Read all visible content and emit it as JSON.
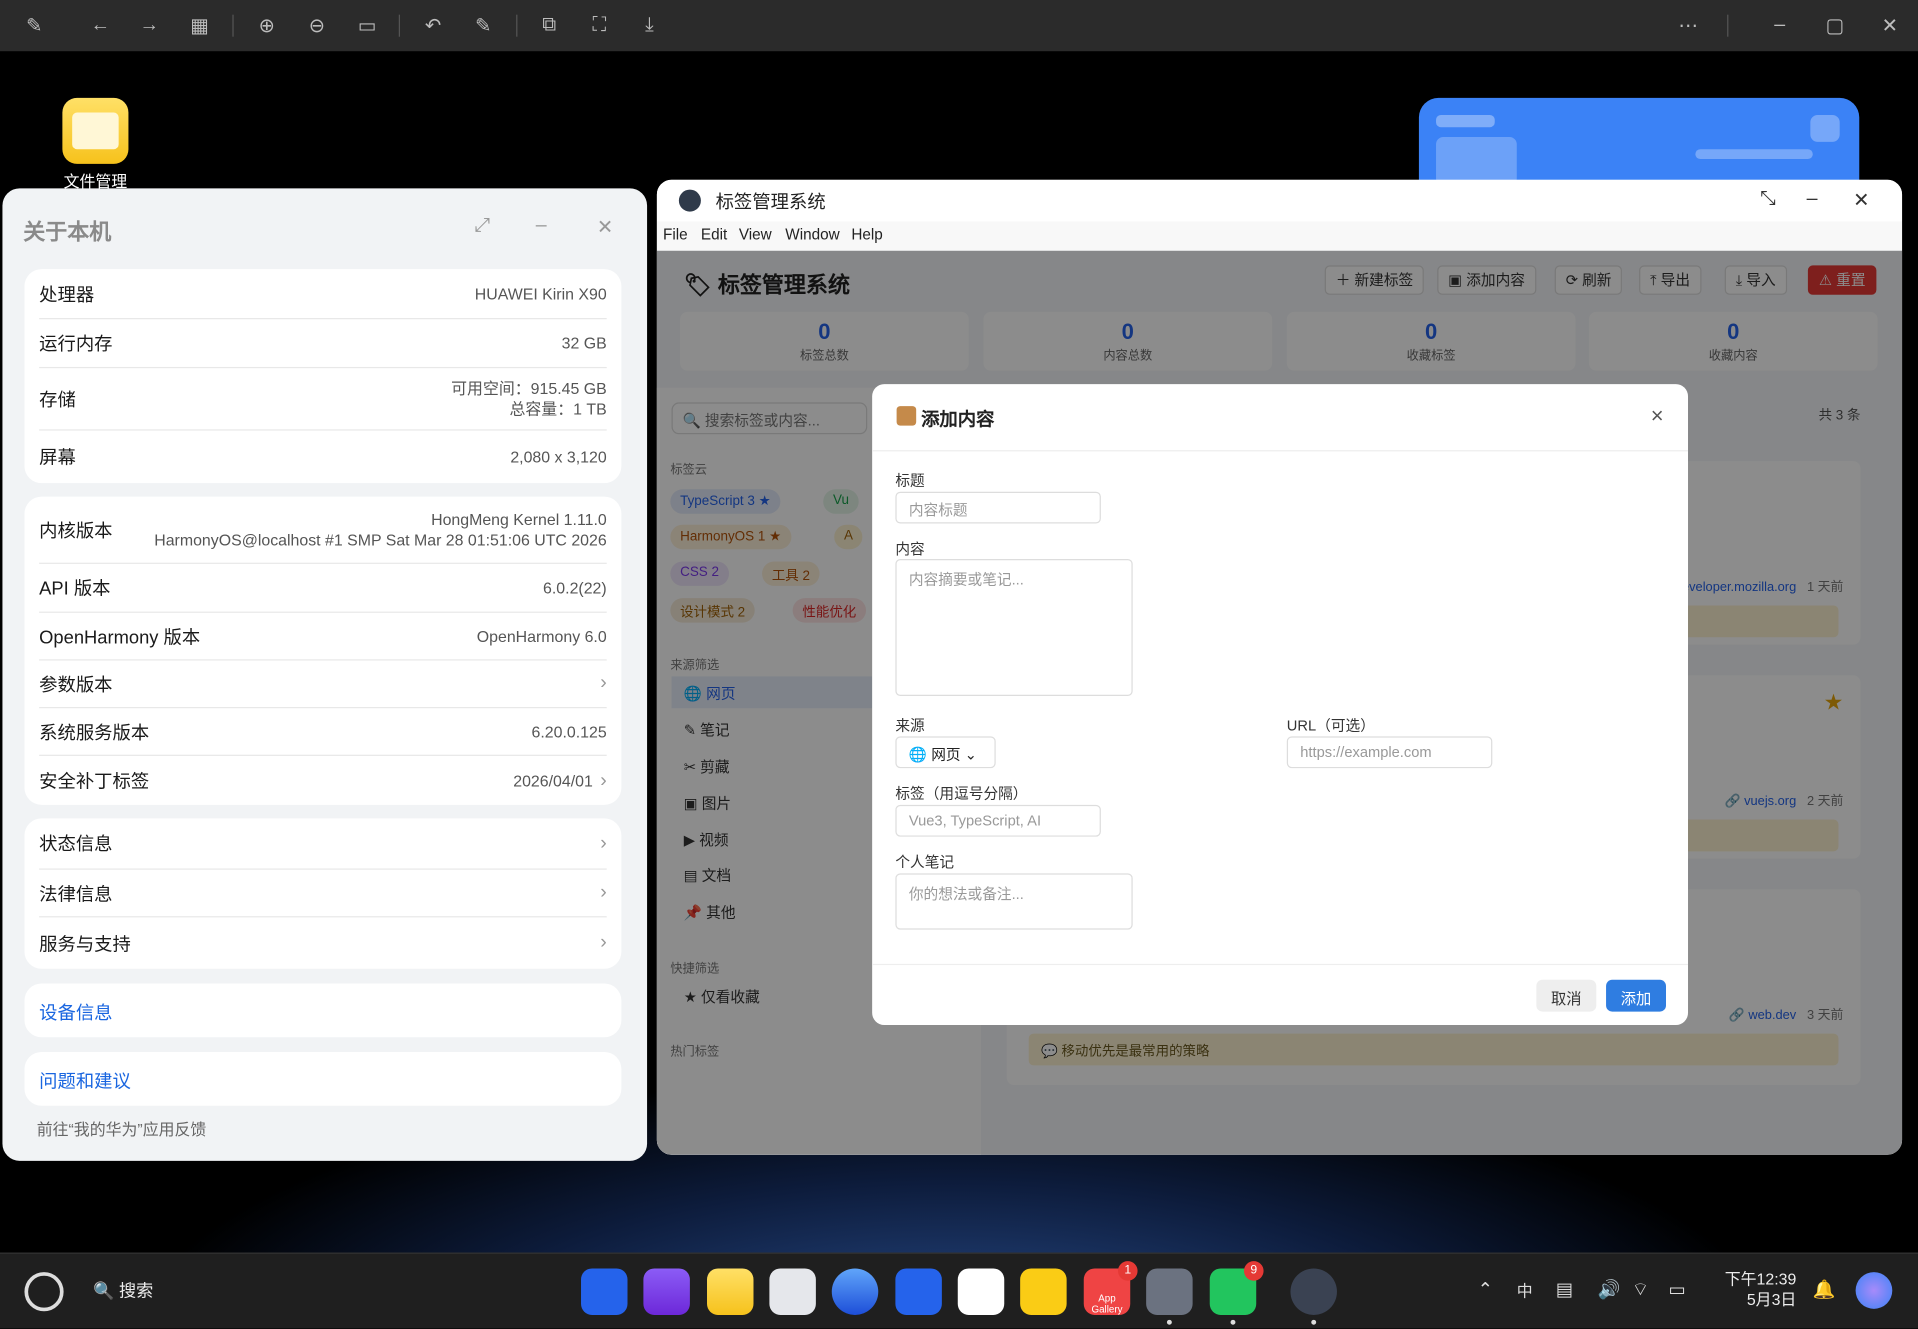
{
  "viewer_toolbar": {
    "icons": [
      "pin-icon",
      "back-icon",
      "forward-icon",
      "grid-icon",
      "zoom-in-icon",
      "zoom-out-icon",
      "actual-size-icon",
      "rotate-icon",
      "edit-icon",
      "crop-icon",
      "fit-icon",
      "save-icon",
      "more-icon",
      "minimize-icon",
      "maximize-icon",
      "close-icon"
    ]
  },
  "desktop": {
    "file_manager_label": "文件管理"
  },
  "about": {
    "title": "关于本机",
    "rows1": [
      {
        "k": "处理器",
        "v": "HUAWEI Kirin X90"
      },
      {
        "k": "运行内存",
        "v": "32 GB"
      },
      {
        "k": "存储",
        "v": "可用空间：915.45 GB",
        "v2": "总容量：1 TB"
      },
      {
        "k": "屏幕",
        "v": "2,080 x 3,120"
      }
    ],
    "rows2": [
      {
        "k": "内核版本",
        "v": "HongMeng Kernel 1.11.0",
        "v2": "HarmonyOS@localhost #1 SMP Sat Mar 28 01:51:06 UTC 2026"
      },
      {
        "k": "API 版本",
        "v": "6.0.2(22)"
      },
      {
        "k": "OpenHarmony 版本",
        "v": "OpenHarmony 6.0"
      },
      {
        "k": "参数版本",
        "v": ""
      },
      {
        "k": "系统服务版本",
        "v": "6.20.0.125"
      },
      {
        "k": "安全补丁标签",
        "v": "2026/04/01"
      }
    ],
    "rows3": [
      {
        "k": "状态信息"
      },
      {
        "k": "法律信息"
      },
      {
        "k": "服务与支持"
      }
    ],
    "device_info": "设备信息",
    "feedback": "问题和建议",
    "feedback_hint": "前往“我的华为”应用反馈"
  },
  "tagwin": {
    "window_title": "标签管理系统",
    "menu": [
      "File",
      "Edit",
      "View",
      "Window",
      "Help"
    ],
    "app_title": "标签管理系统",
    "buttons": {
      "new_tag": "新建标签",
      "add_content": "添加内容",
      "refresh": "刷新",
      "export": "导出",
      "import": "导入",
      "reset": "重置"
    },
    "stats": [
      {
        "n": "0",
        "l": "标签总数"
      },
      {
        "n": "0",
        "l": "内容总数"
      },
      {
        "n": "0",
        "l": "收藏标签"
      },
      {
        "n": "0",
        "l": "收藏内容"
      }
    ],
    "search_placeholder": "搜索标签或内容...",
    "tag_cloud_title": "标签云",
    "tags": [
      {
        "name": "TypeScript",
        "count": "3",
        "color": "#2563eb"
      },
      {
        "name": "Vu",
        "count": "",
        "color": "#16a34a"
      },
      {
        "name": "HarmonyOS",
        "count": "1",
        "color": "#f59e0b"
      },
      {
        "name": "A",
        "count": "",
        "color": "#eab308"
      },
      {
        "name": "CSS",
        "count": "2",
        "color": "#7c3aed"
      },
      {
        "name": "工具",
        "count": "2",
        "color": "#d97706"
      },
      {
        "name": "设计模式",
        "count": "2",
        "color": "#a16207"
      },
      {
        "name": "性能优化",
        "count": "",
        "color": "#dc2626"
      }
    ],
    "source_filter_title": "来源筛选",
    "sources": [
      "网页",
      "笔记",
      "剪藏",
      "图片",
      "视频",
      "文档",
      "其他"
    ],
    "quick_filter_title": "快捷筛选",
    "favorites_only": "仅看收藏",
    "hot_tags_title": "热门标签",
    "count_label": "共 3 条",
    "items": [
      {
        "site": "developer.mozilla.org",
        "time": "1 天前",
        "note": ""
      },
      {
        "site": "vuejs.org",
        "time": "2 天前",
        "note": ""
      },
      {
        "site": "web.dev",
        "time": "3 天前",
        "note": "移动优先是最常用的策略"
      }
    ]
  },
  "modal": {
    "title": "添加内容",
    "title_label": "标题",
    "title_placeholder": "内容标题",
    "content_label": "内容",
    "content_placeholder": "内容摘要或笔记...",
    "source_label": "来源",
    "source_value": "网页",
    "url_label": "URL（可选）",
    "url_placeholder": "https://example.com",
    "tags_label": "标签（用逗号分隔）",
    "tags_placeholder": "Vue3, TypeScript, AI",
    "notes_label": "个人笔记",
    "notes_placeholder": "你的想法或备注...",
    "cancel": "取消",
    "submit": "添加"
  },
  "taskbar": {
    "search_label": "搜索",
    "app_gallery_badge": "1",
    "wechat_badge": "9",
    "app_gallery_label": "App Gallery",
    "ime": "中",
    "time": "下午12:39",
    "date": "5月3日"
  }
}
